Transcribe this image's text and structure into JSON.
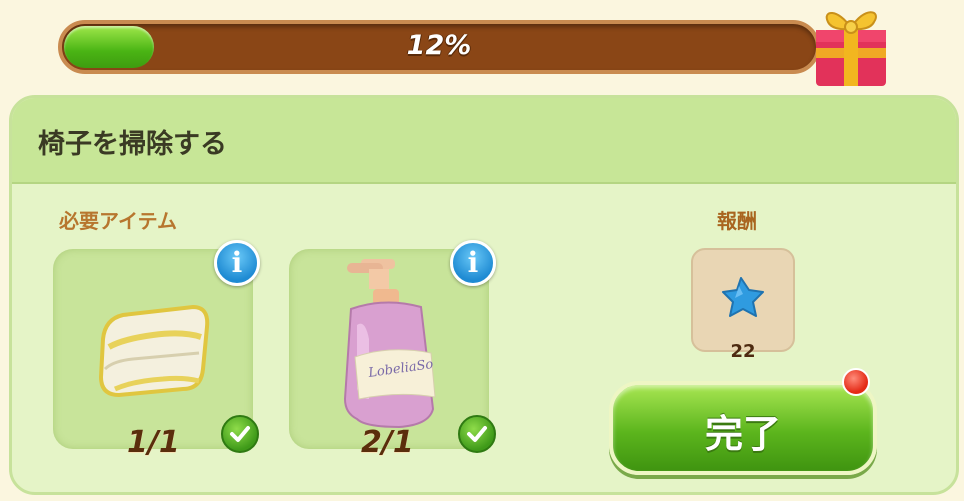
{
  "progress": {
    "value_percent": 12,
    "label": "12%"
  },
  "gift": {
    "icon": "gift-box-icon"
  },
  "task": {
    "title": "椅子を掃除する"
  },
  "required": {
    "label": "必要アイテム",
    "items": [
      {
        "name": "towel",
        "icon": "towel-icon",
        "count": "1/1",
        "complete": true
      },
      {
        "name": "soap-bottle",
        "icon": "soap-bottle-icon",
        "count": "2/1",
        "complete": true,
        "bottle_text": "LobeliaSo"
      }
    ]
  },
  "reward": {
    "label": "報酬",
    "icon": "blue-star-icon",
    "count": "22"
  },
  "complete_button": {
    "label": "完了"
  },
  "colors": {
    "accent_green": "#5cb51d",
    "panel_bg": "#e5f4c7",
    "progress_track": "#8a4616",
    "info_blue": "#1f8bd3"
  }
}
